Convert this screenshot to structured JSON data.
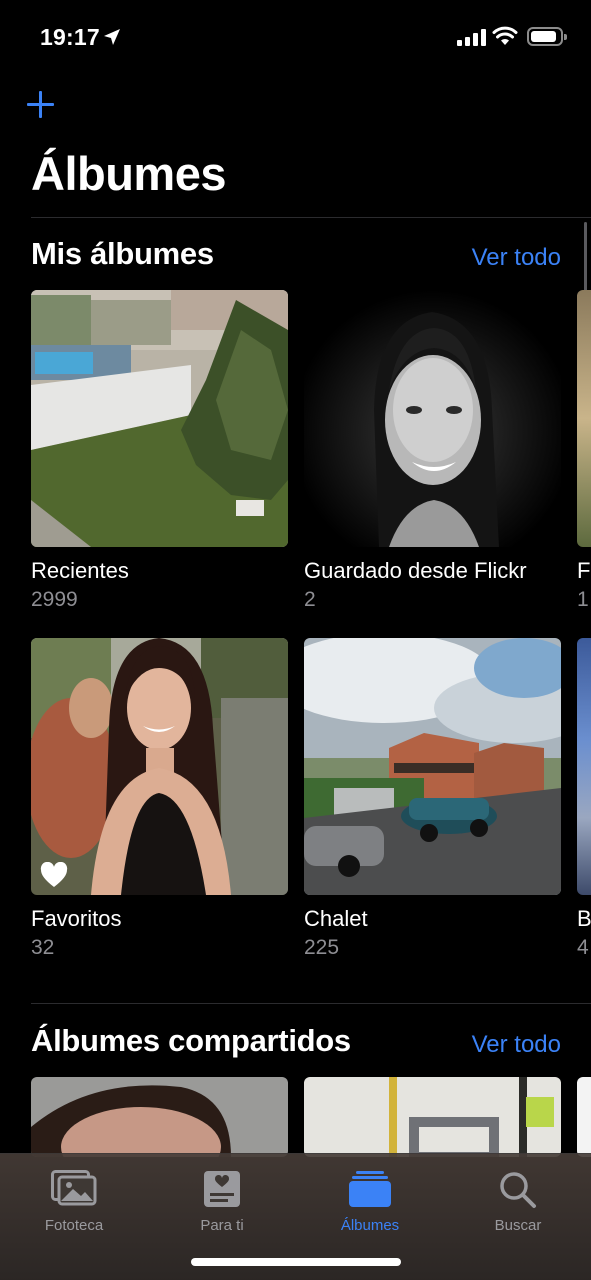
{
  "status_bar": {
    "time": "19:17"
  },
  "header": {
    "title": "Álbumes"
  },
  "my_albums": {
    "title": "Mis álbumes",
    "see_all": "Ver todo",
    "albums": [
      {
        "name": "Recientes",
        "count": "2999"
      },
      {
        "name": "Guardado desde Flickr",
        "count": "2"
      },
      {
        "name": "Favoritos",
        "count": "32"
      },
      {
        "name": "Chalet",
        "count": "225"
      }
    ],
    "peek_labels": [
      "F",
      "1",
      "B",
      "4"
    ]
  },
  "shared_albums": {
    "title": "Álbumes compartidos",
    "see_all": "Ver todo"
  },
  "tab_bar": {
    "tabs": [
      {
        "label": "Fototeca",
        "icon": "photo-library-icon"
      },
      {
        "label": "Para ti",
        "icon": "for-you-icon"
      },
      {
        "label": "Álbumes",
        "icon": "albums-icon",
        "active": true
      },
      {
        "label": "Buscar",
        "icon": "search-icon"
      }
    ]
  },
  "colors": {
    "accent": "#3b82f6",
    "secondary_text": "#8e8e93",
    "background": "#000000"
  }
}
